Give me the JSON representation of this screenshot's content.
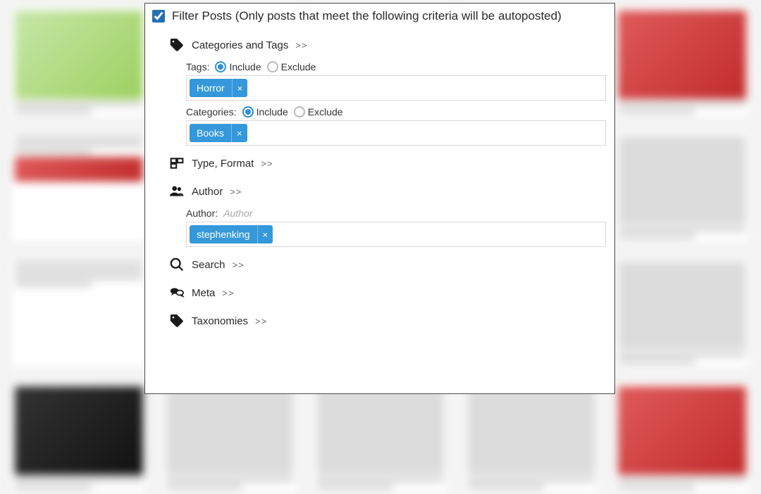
{
  "header": {
    "checked": true,
    "title": "Filter Posts (Only posts that meet the following criteria will be autoposted)"
  },
  "sections": {
    "categories_tags": {
      "label": "Categories and Tags",
      "expand": ">>"
    },
    "type_format": {
      "label": "Type, Format",
      "expand": ">>"
    },
    "author": {
      "label": "Author",
      "expand": ">>"
    },
    "search": {
      "label": "Search",
      "expand": ">>"
    },
    "meta": {
      "label": "Meta",
      "expand": ">>"
    },
    "taxonomies": {
      "label": "Taxonomies",
      "expand": ">>"
    }
  },
  "fields": {
    "tags": {
      "label": "Tags:",
      "mode_include": "Include",
      "mode_exclude": "Exclude",
      "selected_mode": "include",
      "chips": [
        "Horror"
      ]
    },
    "categories": {
      "label": "Categories:",
      "mode_include": "Include",
      "mode_exclude": "Exclude",
      "selected_mode": "include",
      "chips": [
        "Books"
      ]
    },
    "author": {
      "label": "Author:",
      "placeholder": "Author",
      "chips": [
        "stephenking"
      ]
    }
  }
}
